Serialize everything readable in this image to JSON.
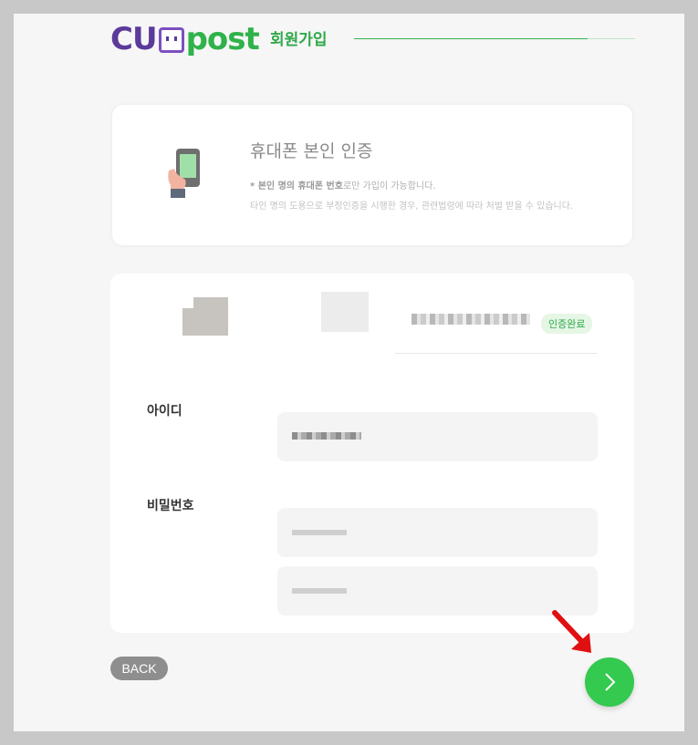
{
  "header": {
    "logo_cu": "CU",
    "logo_post": "post",
    "title": "회원가입"
  },
  "verify": {
    "title": "휴대폰 본인 인증",
    "note1_bold": "* 본인 명의 휴대폰 번호",
    "note1_rest": "로만 가입이 가능합니다.",
    "note2": "타인 명의 도용으로 부정인증을 시행한 경우, 관련법령에 따라 처벌 받을 수 있습니다."
  },
  "form": {
    "verified_badge": "인증완료",
    "id_label": "아이디",
    "password_label": "비밀번호"
  },
  "footer": {
    "back_label": "BACK"
  },
  "colors": {
    "brand_green": "#34c94f",
    "brand_purple": "#5b3a9a",
    "annotation_red": "#e01010"
  }
}
